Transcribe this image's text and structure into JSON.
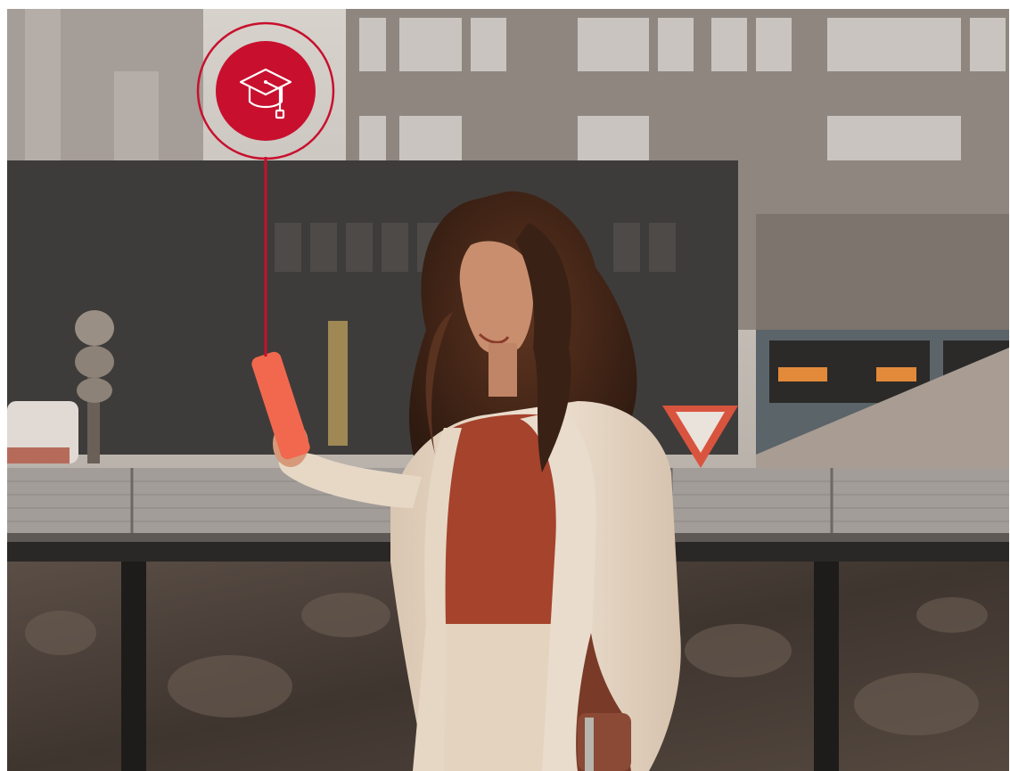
{
  "colors": {
    "accent": "#c8102e",
    "accent_ring": "#c8102e",
    "phone": "#f2684f",
    "coat": "#e8d8c6",
    "top": "#a5432d",
    "hair": "#4a2a1a",
    "wall_cap": "#9c9893",
    "rock": "#4a3f38",
    "building_dark": "#3e3c3a",
    "building_light": "#8f8680"
  },
  "icons": {
    "badge": "graduation-cap-icon"
  },
  "scene": {
    "subject": "woman-looking-at-phone",
    "setting": "city-street-railing"
  }
}
